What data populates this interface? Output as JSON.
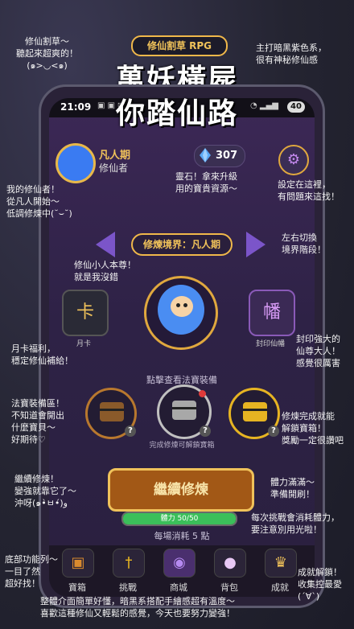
{
  "header": {
    "tag": "修仙割草 RPG",
    "title_line1": "萬妖橫屍",
    "title_line2": "你踏仙路"
  },
  "status_bar": {
    "time": "21:09",
    "battery": "40"
  },
  "player": {
    "rank": "凡人期",
    "role": "修仙者"
  },
  "gems": {
    "value": "307"
  },
  "realm": {
    "label": "修煉境界：凡人期"
  },
  "left_button": {
    "glyph": "卡",
    "caption": "月卡"
  },
  "right_button": {
    "glyph": "幡",
    "caption": "封印仙幡"
  },
  "equipment": {
    "hint": "點擊查看法寶裝備",
    "unlock_hint": "完成修煉可解鎖寶箱",
    "slot_badge": "?"
  },
  "cultivate_button": {
    "label": "繼續修煉"
  },
  "stamina": {
    "text": "體力 50/50",
    "fraction": 1.0
  },
  "cost_note": "每場消耗 5 點",
  "nav": [
    {
      "label": "寶箱",
      "icon": "treasure-chest-icon"
    },
    {
      "label": "挑戰",
      "icon": "sword-icon"
    },
    {
      "label": "商城",
      "icon": "shop-book-icon"
    },
    {
      "label": "背包",
      "icon": "bag-icon"
    },
    {
      "label": "成就",
      "icon": "trophy-icon"
    }
  ],
  "annotations": {
    "top_left": "修仙割草～\n聽起來超爽的！\n(๑>◡<๑)",
    "top_right": "主打暗黑紫色系，\n很有神秘修仙感",
    "player": "我的修仙者！\n從凡人開始～\n低調修煉中(˘⌣˘)",
    "gems": "靈石！拿來升級\n用的寶貴資源～",
    "settings": "設定在這裡，\n有問題來這找！",
    "realm": "左右切換\n境界階段！",
    "hero": "修仙小人本尊！\n就是我沒錯",
    "monthly": "月卡福利，\n穩定修仙補給！",
    "banner": "封印強大的\n仙尊大人！\n感覺很厲害",
    "equipment": "法寶裝備區！\n不知道會開出\n什麼寶貝～\n好期待♡",
    "chests": "修煉完成就能\n解鎖寶箱！\n獎勵一定很讚吧",
    "cultivate": "繼續修煉！\n變強就靠它了～\n沖呀(๑•̀ㅂ•́)و",
    "stamina": "體力滿滿～\n準備開刷！",
    "cost": "每次挑戰會消耗體力，\n要注意別用光啦！",
    "nav_left": "底部功能列～\n一目了然\n超好找！",
    "achievement": "成就解鎖！\n收集控最愛(´∀`)",
    "bottom": "整體介面簡單好懂，暗黑系搭配手繪感超有溫度～\n喜歡這種修仙又輕鬆的感覺，今天也要努力變強！"
  }
}
